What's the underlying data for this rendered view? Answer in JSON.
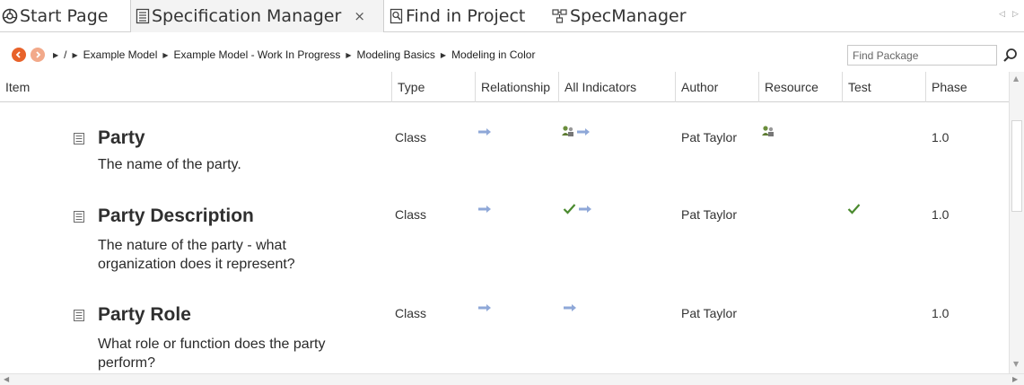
{
  "tabs": [
    {
      "label": "Start Page",
      "icon": "start-page-icon",
      "active": false
    },
    {
      "label": "Specification Manager",
      "icon": "document-icon",
      "active": true,
      "close": "×"
    },
    {
      "label": "Find in Project",
      "icon": "find-icon",
      "active": false
    },
    {
      "label": "SpecManager",
      "icon": "diagram-icon",
      "active": false
    }
  ],
  "tab_scroll": {
    "left": "◁",
    "right": "▷"
  },
  "breadcrumb": {
    "root": "/",
    "items": [
      "Example Model",
      "Example Model - Work In Progress",
      "Modeling Basics",
      "Modeling in Color"
    ]
  },
  "find": {
    "placeholder": "Find Package"
  },
  "columns": [
    "Item",
    "Type",
    "Relationship",
    "All Indicators",
    "Author",
    "Resource",
    "Test",
    "Phase"
  ],
  "rows": [
    {
      "name": "Party",
      "description": "The name of the party.",
      "type": "Class",
      "relationship": "arrow-right-icon",
      "indicators": [
        "resource-icon",
        "arrow-right-icon"
      ],
      "author": "Pat Taylor",
      "resource": "resource-icon",
      "test": "",
      "phase": "1.0"
    },
    {
      "name": "Party Description",
      "description": "The nature of the party - what organization does it represent?",
      "type": "Class",
      "relationship": "arrow-right-icon",
      "indicators": [
        "check-icon",
        "arrow-right-icon"
      ],
      "author": "Pat Taylor",
      "resource": "",
      "test": "check-icon",
      "phase": "1.0"
    },
    {
      "name": "Party Role",
      "description": "What role or function does the party perform?",
      "type": "Class",
      "relationship": "arrow-right-icon",
      "indicators": [
        "arrow-right-icon"
      ],
      "author": "Pat Taylor",
      "resource": "",
      "test": "",
      "phase": "1.0"
    }
  ],
  "colors": {
    "arrow": "#8fa8d8",
    "check": "#4a8a2e",
    "nav_back": "#e8622a",
    "nav_forward": "#f2a98a"
  }
}
